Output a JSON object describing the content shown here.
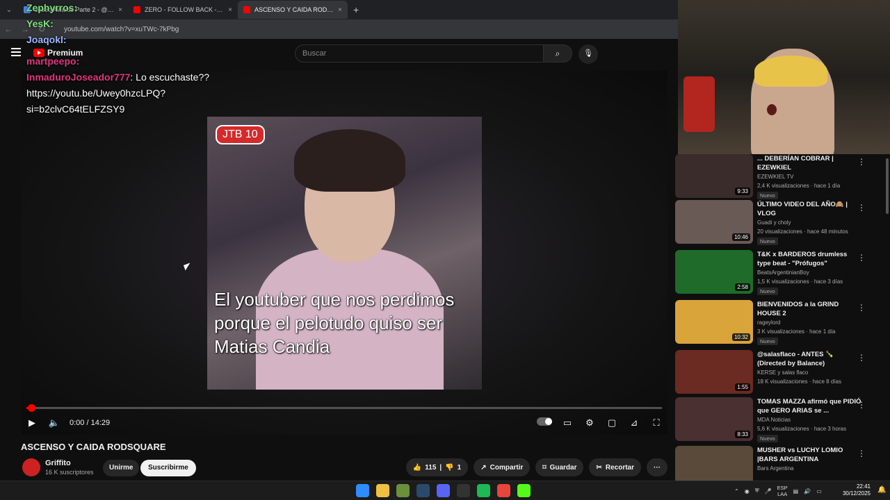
{
  "browser": {
    "tabs": [
      {
        "label": "Joseo Awards Parte 2 - @alitas",
        "color": "#4a86e8"
      },
      {
        "label": "ZERO - FOLLOW BACK - YouTube",
        "color": "#ff0000"
      },
      {
        "label": "ASCENSO Y CAIDA RODSQUARE",
        "color": "#ff0000"
      }
    ],
    "close": "×",
    "new_tab": "+",
    "url": "youtube.com/watch?v=xuTWc-7kPbg"
  },
  "header": {
    "logo": "Premium",
    "search_placeholder": "Buscar",
    "search_icon": "search-icon",
    "mic_icon": "mic-icon"
  },
  "chat": [
    {
      "user": "Zephyrros:",
      "msg": "",
      "color": "#7fe07f"
    },
    {
      "user": "YesK:",
      "msg": "",
      "color": "#7fe07f"
    },
    {
      "user": "Joaqokl:",
      "msg": "",
      "color": "#9ab7ff"
    },
    {
      "user": "martpeepo:",
      "msg": "",
      "color": "#e0357b"
    },
    {
      "user": "InmaduroJoseador777",
      "msg": ": Lo escuchaste??",
      "color": "#e0357b"
    },
    {
      "user": "",
      "msg": "https://youtu.be/Uwey0hzcLPQ?",
      "color": "#fff"
    },
    {
      "user": "",
      "msg": "si=b2clvC64tELFZSY9",
      "color": "#fff"
    }
  ],
  "video": {
    "badge": "JTB 10",
    "caption": "El youtuber que nos perdimos porque el pelotudo quiso ser Matias Candia",
    "time": "0:00 / 14:29",
    "progress": 0.0,
    "title": "ASCENSO Y CAIDA RODSQUARE"
  },
  "channel": {
    "name": "Griffito",
    "subs": "16 K suscriptores",
    "join": "Unirme",
    "subscribe": "Suscribirme"
  },
  "actions": {
    "likes": "115",
    "dislikes": "1",
    "share": "Compartir",
    "save": "Guardar",
    "clip": "Recortar",
    "more": "···"
  },
  "sidebar": [
    {
      "title": "... DEBERÍAN COBRAR | EZEWKIEL",
      "channel": "EZEWKIEL TV",
      "meta": "2,4 K visualizaciones · hace 1 día",
      "badge": "Nuevo",
      "duration": "9:33",
      "color": "#3a2c2a"
    },
    {
      "title": "ÚLTIMO VIDEO DEL AÑO🙈 | VLOG",
      "channel": "Guadi y choly",
      "meta": "20 visualizaciones · hace 48 minutos",
      "badge": "Nuevo",
      "duration": "10:46",
      "color": "#6a5a55"
    },
    {
      "title": "T&K x BARDEROS drumless type beat - \"Prófugos\"",
      "channel": "BeatsArgentinianBoy",
      "meta": "1,5 K visualizaciones · hace 3 días",
      "badge": "Nuevo",
      "duration": "2:58",
      "color": "#1e6b2a"
    },
    {
      "title": "BIENVENIDOS a la GRIND HOUSE 2",
      "channel": "rageylord",
      "meta": "3 K visualizaciones · hace 1 día",
      "badge": "Nuevo",
      "duration": "10:32",
      "color": "#d9a43a"
    },
    {
      "title": "@salasflaco - ANTES 🍾 (Directed by Balance)",
      "channel": "KERSE y salas flaco",
      "meta": "18 K visualizaciones · hace 8 días",
      "badge": "",
      "duration": "1:55",
      "color": "#6b2a22"
    },
    {
      "title": "TOMAS MAZZA afirmó que PIDIÓ que GERO ARIAS se ...",
      "channel": "MDA Noticias",
      "meta": "5,6 K visualizaciones · hace 3 horas",
      "badge": "Nuevo",
      "duration": "8:33",
      "color": "#4a3030"
    },
    {
      "title": "MUSHER vs LUCHY LOMIO |BARS ARGENTINA",
      "channel": "Bars Argentina",
      "meta": "",
      "badge": "",
      "duration": "",
      "color": "#5a4a3a"
    }
  ],
  "taskbar": {
    "lang1": "ESP",
    "lang2": "LAA",
    "time": "22:41",
    "date": "30/12/2025",
    "icons": [
      "windows-icon",
      "explorer-icon",
      "app-icon",
      "steam-icon",
      "discord-icon",
      "obs-icon",
      "spotify-icon",
      "chrome-icon",
      "kick-icon"
    ],
    "icon_colors": [
      "#2f8cff",
      "#f0c040",
      "#6b8f3a",
      "#2b4a6b",
      "#5865f2",
      "#333333",
      "#1db954",
      "#e8453c",
      "#53fc18"
    ]
  }
}
